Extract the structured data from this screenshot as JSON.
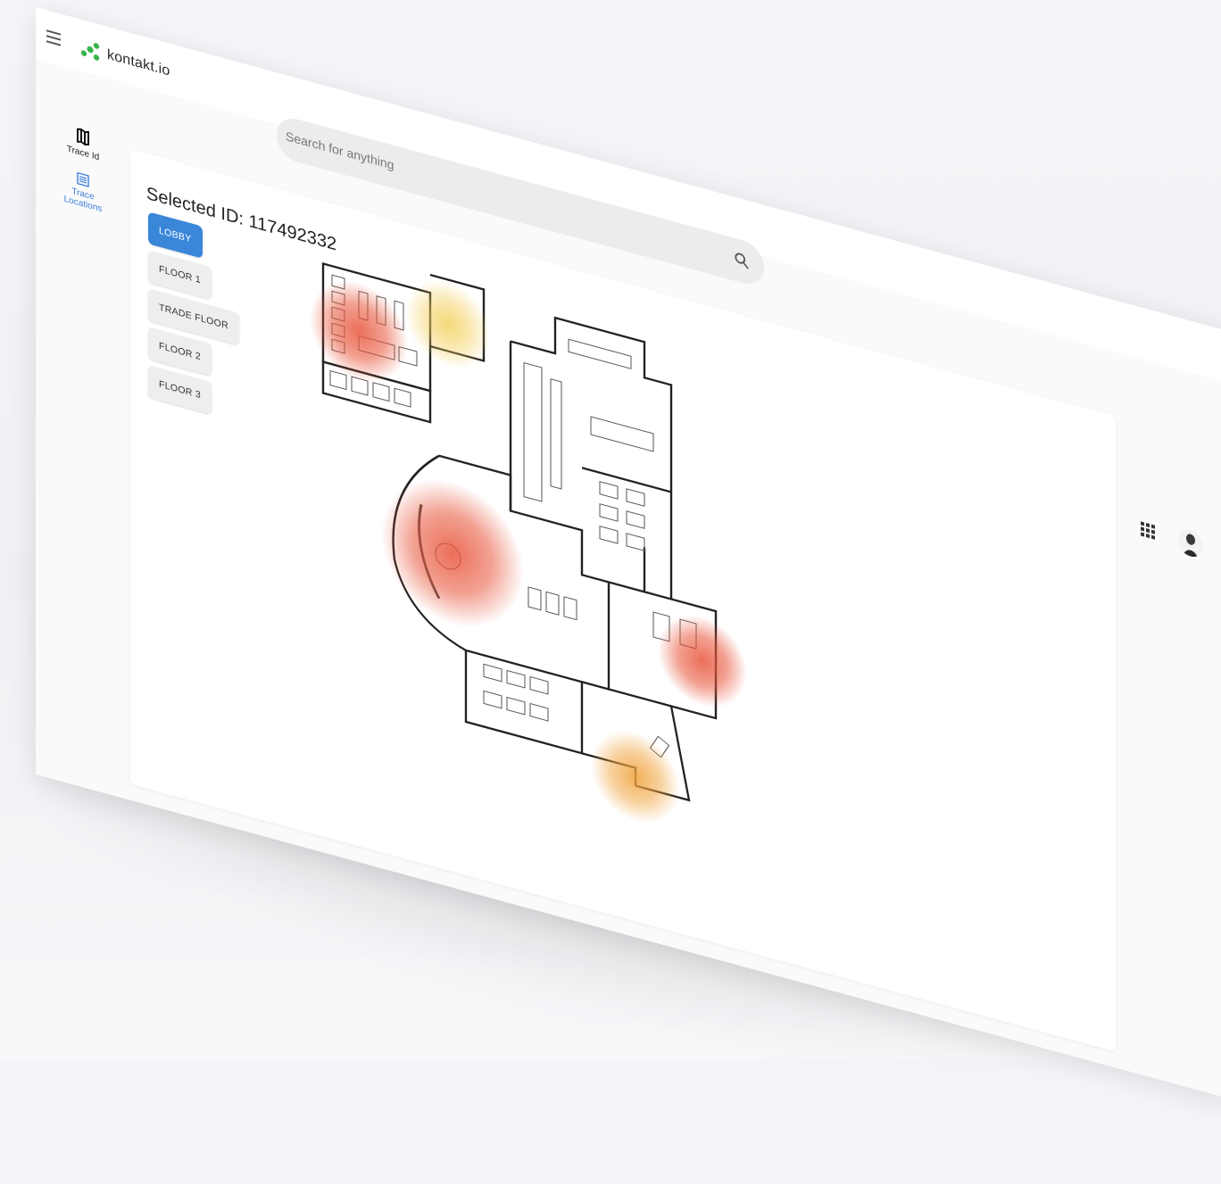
{
  "app": {
    "brand": "kontakt.io",
    "brand_color": "#3ab54a"
  },
  "search": {
    "placeholder": "Search for anything"
  },
  "sidebar": {
    "items": [
      {
        "label": "Trace Id",
        "icon": "map-icon",
        "active": false
      },
      {
        "label": "Trace Locations",
        "icon": "list-icon",
        "active": true
      }
    ]
  },
  "main": {
    "selected_title": "Selected ID: 117492332",
    "floors": [
      {
        "label": "LOBBY",
        "active": true
      },
      {
        "label": "FLOOR 1",
        "active": false
      },
      {
        "label": "TRADE FLOOR",
        "active": false
      },
      {
        "label": "FLOOR 2",
        "active": false
      },
      {
        "label": "FLOOR 3",
        "active": false
      }
    ]
  },
  "colors": {
    "accent": "#3a86d9",
    "heat_hot": "#e8553a",
    "heat_warm": "#f0a23a",
    "heat_mild": "#f3cf58"
  }
}
